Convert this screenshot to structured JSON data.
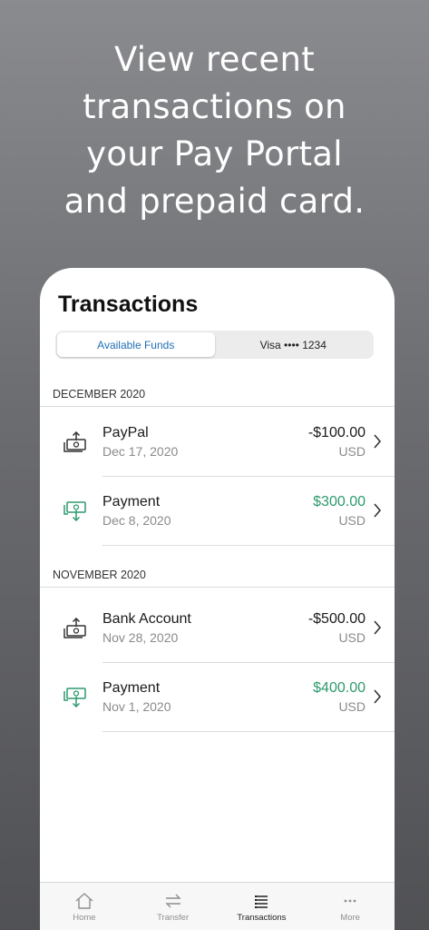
{
  "headline": {
    "line1": "View recent",
    "line2": "transactions on",
    "line3": "your Pay Portal",
    "line4": "and prepaid card."
  },
  "screen": {
    "title": "Transactions",
    "segments": [
      {
        "label": "Available Funds",
        "selected": true
      },
      {
        "label": "Visa •••• 1234",
        "selected": false
      }
    ]
  },
  "sections": [
    {
      "header": "DECEMBER 2020",
      "transactions": [
        {
          "name": "PayPal",
          "date": "Dec 17, 2020",
          "amount": "-$100.00",
          "currency": "USD",
          "type": "debit",
          "icon": "money-out-icon"
        },
        {
          "name": "Payment",
          "date": "Dec 8, 2020",
          "amount": "$300.00",
          "currency": "USD",
          "type": "credit",
          "icon": "money-in-icon"
        }
      ]
    },
    {
      "header": "NOVEMBER 2020",
      "transactions": [
        {
          "name": "Bank Account",
          "date": "Nov 28, 2020",
          "amount": "-$500.00",
          "currency": "USD",
          "type": "debit",
          "icon": "money-out-icon"
        },
        {
          "name": "Payment",
          "date": "Nov 1, 2020",
          "amount": "$400.00",
          "currency": "USD",
          "type": "credit",
          "icon": "money-in-icon"
        }
      ]
    }
  ],
  "tabbar": {
    "items": [
      {
        "label": "Home",
        "icon": "home-icon",
        "active": false
      },
      {
        "label": "Transfer",
        "icon": "transfer-icon",
        "active": false
      },
      {
        "label": "Transactions",
        "icon": "list-icon",
        "active": true
      },
      {
        "label": "More",
        "icon": "more-icon",
        "active": false
      }
    ]
  },
  "colors": {
    "credit": "#2e9a6d",
    "accent": "#1f6fb5",
    "icon_dark": "#333333"
  }
}
